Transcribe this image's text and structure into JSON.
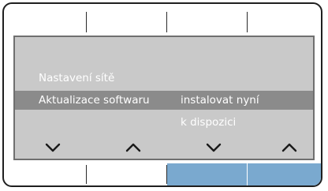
{
  "screen": {
    "menu": {
      "previous_item": "Nastavení sítě",
      "current_item": {
        "label": "Aktualizace softwaru",
        "value": "instalovat nyní"
      },
      "next_value": "k dispozici"
    },
    "navigation": [
      {
        "icon": "chevron-down-icon"
      },
      {
        "icon": "chevron-up-icon"
      },
      {
        "icon": "chevron-down-icon"
      },
      {
        "icon": "chevron-up-icon"
      }
    ]
  },
  "softkeys": {
    "active_color": "#7aa9cf",
    "bottom_active": [
      false,
      false,
      true,
      true
    ]
  },
  "colors": {
    "screen_background": "#c9c9c9",
    "selection_highlight": "#8b8b8b",
    "text": "#ffffff"
  }
}
